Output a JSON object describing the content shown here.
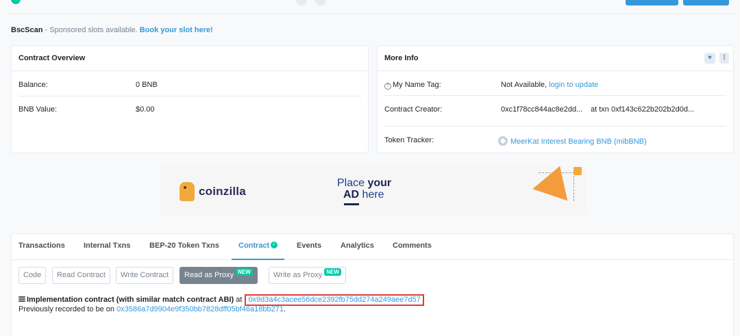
{
  "sponsored": {
    "brand": "BscScan",
    "text": " - Sponsored slots available. ",
    "link": "Book your slot here!"
  },
  "overview": {
    "title": "Contract Overview",
    "balance_label": "Balance:",
    "balance_value": "0 BNB",
    "value_label": "BNB Value:",
    "value_value": "$0.00"
  },
  "more_info": {
    "title": "More Info",
    "name_tag_label": "My Name Tag:",
    "name_tag_value": "Not Available, ",
    "name_tag_link": "login to update",
    "creator_label": "Contract Creator:",
    "creator_address": "0xc1f78cc844ac8e2dd...",
    "at_txn": "at txn",
    "creator_txn": "0xf143c622b202b2d0d...",
    "tracker_label": "Token Tracker:",
    "tracker_value": "MeerKat Interest Bearing BNB (mibBNB)"
  },
  "ad": {
    "brand": "coinzilla",
    "place": "Place ",
    "your": "your",
    "ad": "AD",
    "here": " here"
  },
  "tabs": [
    {
      "label": "Transactions"
    },
    {
      "label": "Internal Txns"
    },
    {
      "label": "BEP-20 Token Txns"
    },
    {
      "label": "Contract"
    },
    {
      "label": "Events"
    },
    {
      "label": "Analytics"
    },
    {
      "label": "Comments"
    }
  ],
  "subtabs": {
    "code": "Code",
    "read": "Read Contract",
    "write": "Write Contract",
    "read_proxy": "Read as Proxy",
    "write_proxy": "Write as Proxy",
    "new_badge": "NEW"
  },
  "implementation": {
    "label": "Implementation contract (with similar match contract ABI)",
    "at": " at ",
    "address": "0x9d3a4c3acee56dce2392fb75dd274a249aee7d57",
    "prev_text": "Previously recorded to be on ",
    "prev_address": "0x3586a7d9904e9f350bb7828dff05bf46a18bb271",
    "prev_end": "."
  },
  "colors": {
    "accent": "#3498db",
    "success": "#00c9a7",
    "highlight_box": "#e53935"
  }
}
